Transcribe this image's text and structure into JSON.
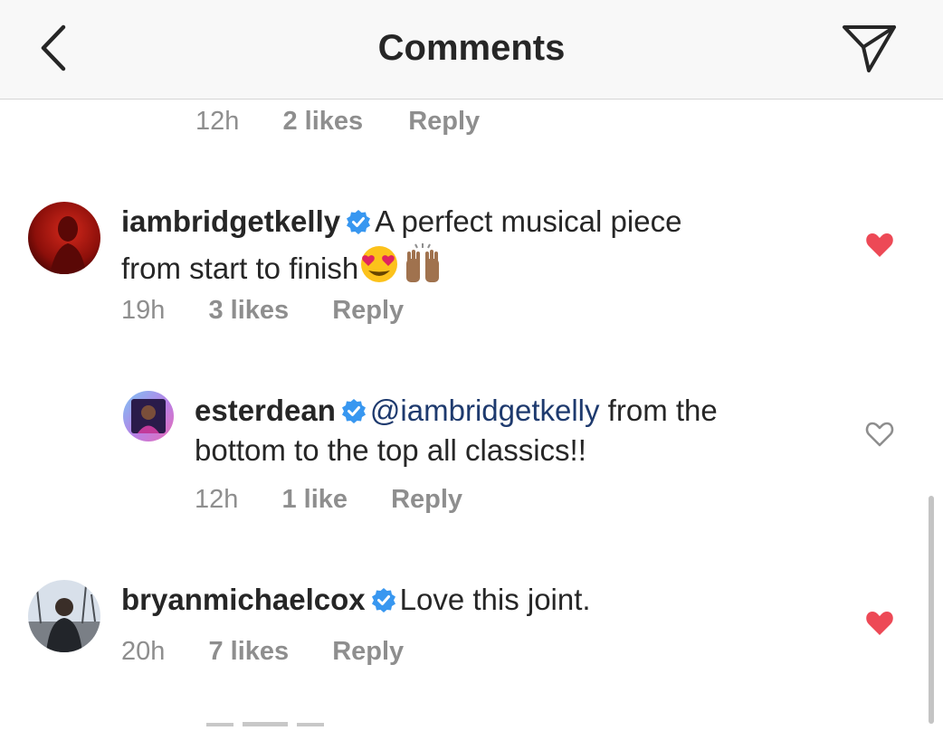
{
  "header": {
    "title": "Comments",
    "back_icon": "chevron-left-icon",
    "share_icon": "paper-plane-icon"
  },
  "colors": {
    "liked_heart": "#ed4956",
    "verified": "#3897f0",
    "meta_text": "#8e8e8e",
    "mention": "#1e3a6e"
  },
  "top_meta": {
    "time": "12h",
    "likes": "2 likes",
    "reply": "Reply"
  },
  "comments": [
    {
      "username": "iambridgetkelly",
      "verified": true,
      "text_line1": "A perfect musical piece",
      "text_line2": "from start to finish",
      "emojis": [
        "heart-eyes-emoji",
        "raising-hands-emoji"
      ],
      "time": "19h",
      "likes": "3 likes",
      "reply": "Reply",
      "liked": true
    },
    {
      "username": "esterdean",
      "verified": true,
      "mention": "@iambridgetkelly",
      "text_line1": " from the",
      "text_line2": "bottom to the top all classics!!",
      "time": "12h",
      "likes": "1 like",
      "reply": "Reply",
      "liked": false
    },
    {
      "username": "bryanmichaelcox",
      "verified": true,
      "text_line1": "Love this joint.",
      "time": "20h",
      "likes": "7 likes",
      "reply": "Reply",
      "liked": true
    }
  ]
}
